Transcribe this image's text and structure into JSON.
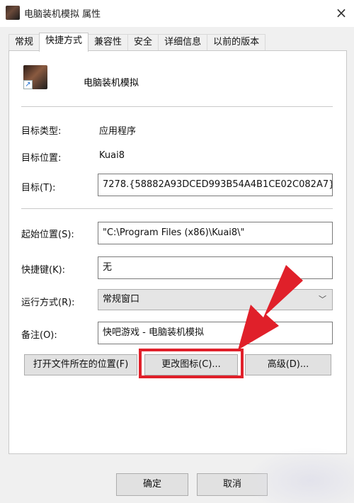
{
  "window": {
    "title": "电脑装机模拟 属性",
    "close_glyph": "×"
  },
  "tabs": [
    {
      "label": "常规",
      "active": false
    },
    {
      "label": "快捷方式",
      "active": true
    },
    {
      "label": "兼容性",
      "active": false
    },
    {
      "label": "安全",
      "active": false
    },
    {
      "label": "详细信息",
      "active": false
    },
    {
      "label": "以前的版本",
      "active": false
    }
  ],
  "shortcut": {
    "app_name": "电脑装机模拟",
    "target_type_label": "目标类型:",
    "target_type_value": "应用程序",
    "target_location_label": "目标位置:",
    "target_location_value": "Kuai8",
    "target_label": "目标(T):",
    "target_value": "7278.{58882A93DCED993B54A4B1CE02C082A7}",
    "start_in_label": "起始位置(S):",
    "start_in_value": "\"C:\\Program Files (x86)\\Kuai8\\\"",
    "hotkey_label": "快捷键(K):",
    "hotkey_value": "无",
    "run_label": "运行方式(R):",
    "run_value": "常规窗口",
    "comment_label": "备注(O):",
    "comment_value": "快吧游戏 - 电脑装机模拟"
  },
  "buttons": {
    "open_location": "打开文件所在的位置(F)",
    "change_icon": "更改图标(C)...",
    "advanced": "高级(D)...",
    "ok": "确定",
    "cancel": "取消"
  },
  "colors": {
    "annotation_red": "#e0202a",
    "dialog_bg": "#f0f0f0"
  }
}
